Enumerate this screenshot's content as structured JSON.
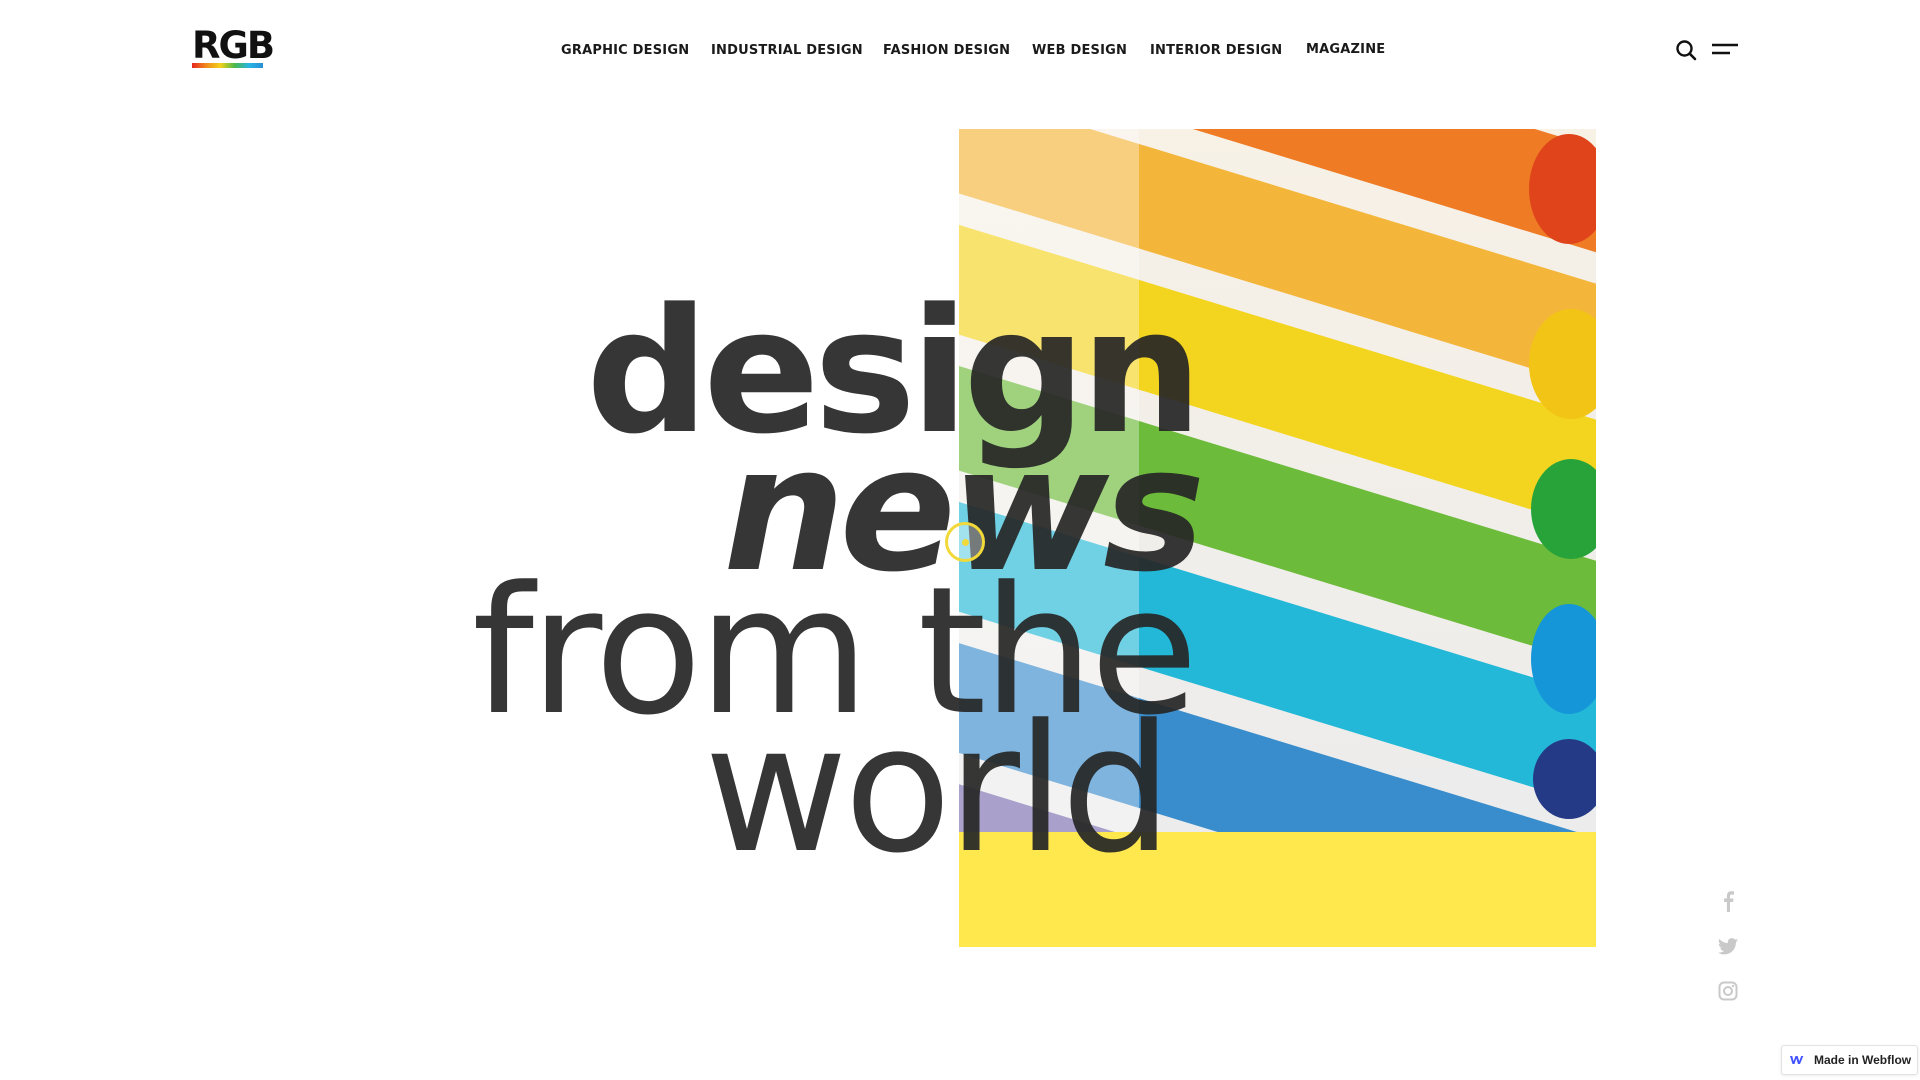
{
  "brand": {
    "logo_text": "RGB",
    "logo_gradient": [
      "#e52620",
      "#f08a1c",
      "#f3d21b",
      "#4db848",
      "#27b5e3",
      "#2a8fd6"
    ]
  },
  "nav": {
    "items": [
      {
        "label": "GRAPHIC DESIGN"
      },
      {
        "label": "INDUSTRIAL DESIGN"
      },
      {
        "label": "FASHION DESIGN"
      },
      {
        "label": "WEB DESIGN"
      },
      {
        "label": "INTERIOR DESIGN"
      },
      {
        "label": "MAGAZINE"
      }
    ],
    "search_icon": "search-icon",
    "menu_icon": "hamburger-menu-icon"
  },
  "hero": {
    "line1": "design",
    "line2": "news",
    "line3": "from the",
    "line4": "world",
    "accent_color": "#fee84d",
    "image_subject": "rainbow-colored-marker-pens"
  },
  "social": {
    "icons": [
      "facebook-icon",
      "twitter-icon",
      "instagram-icon"
    ]
  },
  "badge": {
    "label": "Made in Webflow",
    "icon": "webflow-logo-icon"
  }
}
